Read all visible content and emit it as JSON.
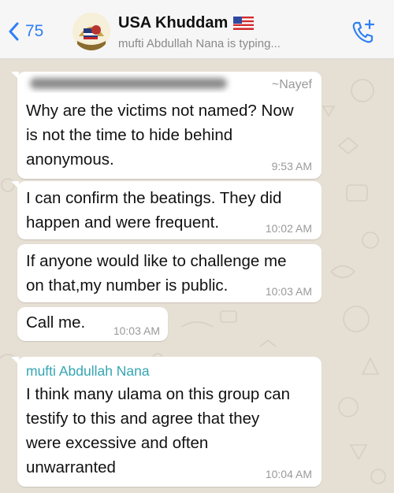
{
  "header": {
    "back_count": "75",
    "chat_title": "USA Khuddam",
    "status": "mufti Abdullah Nana is typing...",
    "icons": {
      "back": "chevron-left-icon",
      "flag": "us-flag-icon",
      "call": "add-call-icon"
    },
    "accent_color": "#2f7ff6"
  },
  "messages": [
    {
      "nickname": "~Nayef",
      "text_lines": [
        "Why are the victims not named? Now",
        "is not the time to hide behind",
        "anonymous."
      ],
      "time": "9:53 AM"
    },
    {
      "text_lines": [
        "I can confirm the beatings. They did",
        "happen and were frequent."
      ],
      "time": "10:02 AM"
    },
    {
      "text_lines": [
        "If anyone would like to challenge me",
        "on that,my number is public."
      ],
      "time": "10:03 AM"
    },
    {
      "text_lines": [
        "Call me."
      ],
      "time": "10:03 AM"
    },
    {
      "sender": "mufti Abdullah Nana",
      "sender_color": "#35a6b4",
      "text_lines": [
        "I think many ulama on this group can",
        "testify to this and agree that they",
        "were excessive and often",
        "unwarranted"
      ],
      "time": "10:04 AM"
    }
  ]
}
